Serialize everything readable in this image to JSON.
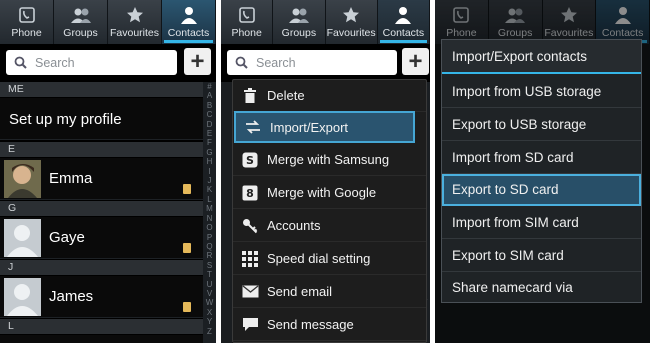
{
  "tabs": [
    {
      "label": "Phone",
      "icon": "phone-icon"
    },
    {
      "label": "Groups",
      "icon": "groups-icon"
    },
    {
      "label": "Favourites",
      "icon": "star-icon"
    },
    {
      "label": "Contacts",
      "icon": "person-icon"
    }
  ],
  "search": {
    "placeholder": "Search",
    "add_label": "+"
  },
  "contacts": {
    "me_header": "ME",
    "setup_profile": "Set up my profile",
    "sections": [
      {
        "header": "E",
        "name": "Emma"
      },
      {
        "header": "G",
        "name": "Gaye"
      },
      {
        "header": "J",
        "name": "James"
      },
      {
        "header": "L",
        "name": ""
      }
    ]
  },
  "index_letters": [
    "#",
    "A",
    "B",
    "C",
    "D",
    "E",
    "F",
    "G",
    "H",
    "I",
    "J",
    "K",
    "L",
    "M",
    "N",
    "O",
    "P",
    "Q",
    "R",
    "S",
    "T",
    "U",
    "V",
    "W",
    "X",
    "Y",
    "Z"
  ],
  "options_menu": [
    {
      "label": "Delete",
      "icon": "trash-icon"
    },
    {
      "label": "Import/Export",
      "icon": "import-export-icon",
      "selected": true
    },
    {
      "label": "Merge with Samsung",
      "icon": "samsung-icon"
    },
    {
      "label": "Merge with Google",
      "icon": "google-icon"
    },
    {
      "label": "Accounts",
      "icon": "key-icon"
    },
    {
      "label": "Speed dial setting",
      "icon": "speed-dial-icon"
    },
    {
      "label": "Send email",
      "icon": "email-icon"
    },
    {
      "label": "Send message",
      "icon": "message-icon"
    }
  ],
  "import_export": {
    "title": "Import/Export contacts",
    "items": [
      {
        "label": "Import from USB storage"
      },
      {
        "label": "Export to USB storage"
      },
      {
        "label": "Import from SD card"
      },
      {
        "label": "Export to SD card",
        "selected": true
      },
      {
        "label": "Import from SIM card"
      },
      {
        "label": "Export to SIM card"
      },
      {
        "label": "Share namecard via"
      }
    ]
  },
  "colors": {
    "accent": "#35b6e8",
    "selected_bg": "#2a546f",
    "badge": "#e5b95a"
  }
}
